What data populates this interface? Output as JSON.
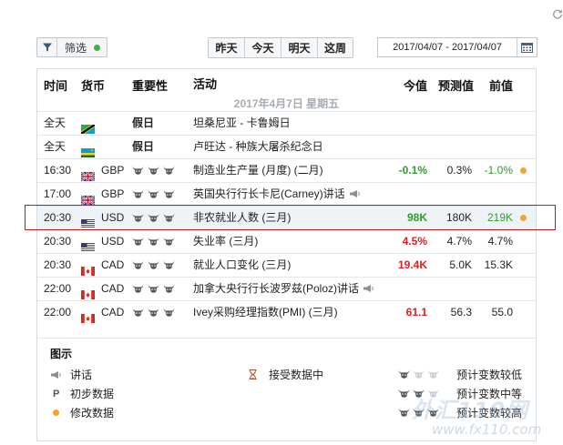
{
  "toolbar": {
    "filter_label": "筛选",
    "day_buttons": [
      "昨天",
      "今天",
      "明天",
      "这周"
    ],
    "date_range": "2017/04/07 - 2017/04/07"
  },
  "table": {
    "headers": {
      "time": "时间",
      "currency": "货币",
      "importance": "重要性",
      "event": "活动",
      "actual": "今值",
      "forecast": "预测值",
      "previous": "前值"
    },
    "date_line": "2017年4月7日  星期五",
    "rows": [
      {
        "time": "全天",
        "flag": "TZ",
        "currency": "",
        "holiday": "假日",
        "event": "坦桑尼亚 - 卡鲁姆日",
        "actual": "",
        "forecast": "",
        "previous": "",
        "revised": false
      },
      {
        "time": "全天",
        "flag": "RW",
        "currency": "",
        "holiday": "假日",
        "event": "卢旺达 - 种族大屠杀纪念日",
        "actual": "",
        "forecast": "",
        "previous": "",
        "revised": false
      },
      {
        "time": "16:30",
        "flag": "GB",
        "currency": "GBP",
        "importance": 3,
        "event": "制造业生产量 (月度) (二月)",
        "actual": "-0.1%",
        "actual_color": "green",
        "forecast": "0.3%",
        "previous": "-1.0%",
        "previous_color": "green",
        "revised": true
      },
      {
        "time": "17:00",
        "flag": "GB",
        "currency": "GBP",
        "importance": 3,
        "event": "英国央行行长卡尼(Carney)讲话",
        "speech": true,
        "actual": "",
        "forecast": "",
        "previous": "",
        "revised": false
      },
      {
        "time": "20:30",
        "flag": "US",
        "currency": "USD",
        "importance": 3,
        "event": "非农就业人数 (三月)",
        "actual": "98K",
        "actual_color": "green",
        "forecast": "180K",
        "previous": "219K",
        "previous_color": "green",
        "revised": true,
        "highlighted": true
      },
      {
        "time": "20:30",
        "flag": "US",
        "currency": "USD",
        "importance": 3,
        "event": "失业率 (三月)",
        "actual": "4.5%",
        "actual_color": "red",
        "forecast": "4.7%",
        "previous": "4.7%",
        "previous_color": "dark",
        "revised": false
      },
      {
        "time": "20:30",
        "flag": "CA",
        "currency": "CAD",
        "importance": 3,
        "event": "就业人口变化 (三月)",
        "actual": "19.4K",
        "actual_color": "red",
        "forecast": "5.0K",
        "previous": "15.3K",
        "previous_color": "dark",
        "revised": false
      },
      {
        "time": "22:00",
        "flag": "CA",
        "currency": "CAD",
        "importance": 3,
        "event": "加拿大央行行长波罗兹(Poloz)讲话",
        "speech": true,
        "actual": "",
        "forecast": "",
        "previous": "",
        "revised": false
      },
      {
        "time": "22:00",
        "flag": "CA",
        "currency": "CAD",
        "importance": 3,
        "event": "Ivey采购经理指数(PMI) (三月)",
        "actual": "61.1",
        "actual_color": "red",
        "forecast": "56.3",
        "previous": "55.0",
        "previous_color": "dark",
        "revised": false
      }
    ]
  },
  "legend": {
    "title": "图示",
    "speech": "讲话",
    "preliminary": "初步数据",
    "revised": "修改数据",
    "receiving": "接受数据中",
    "low_volatility": "预计变数较低",
    "medium_volatility": "预计变数中等",
    "high_volatility": "预计变数较高"
  },
  "watermark": {
    "logo": "外汇110网",
    "url": "www.fx110.com"
  },
  "colors": {
    "green": "#2aa02a",
    "red": "#e02020",
    "revised_dot": "#f0a62a",
    "filter_dot": "#3cb34a",
    "highlight_border": "#c91414"
  }
}
